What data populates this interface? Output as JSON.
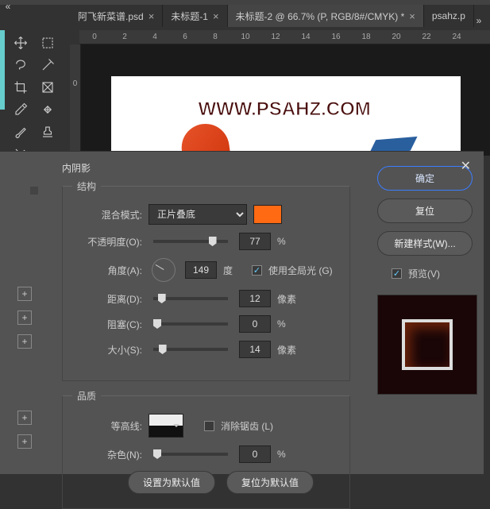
{
  "tabs": [
    {
      "label": "阿飞新菜谱.psd",
      "active": false
    },
    {
      "label": "未标题-1",
      "active": false
    },
    {
      "label": "未标题-2 @ 66.7% (P, RGB/8#/CMYK) *",
      "active": true
    },
    {
      "label": "psahz.p",
      "active": false
    }
  ],
  "ruler": [
    "0",
    "2",
    "4",
    "6",
    "8",
    "10",
    "12",
    "14",
    "16",
    "18",
    "20",
    "22",
    "24"
  ],
  "vruler_marks": [
    "0"
  ],
  "canvas": {
    "watermark": "WWW.PSAHZ.COM"
  },
  "dialog": {
    "effect_title": "内阴影",
    "structure_legend": "结构",
    "quality_legend": "品质",
    "blend_mode_label": "混合模式:",
    "blend_mode_value": "正片叠底",
    "swatch_color": "#ff6a13",
    "opacity_label": "不透明度(O):",
    "opacity_value": "77",
    "opacity_unit": "%",
    "angle_label": "角度(A):",
    "angle_value": "149",
    "angle_unit": "度",
    "global_light_label": "使用全局光 (G)",
    "global_light_checked": true,
    "distance_label": "距离(D):",
    "distance_value": "12",
    "distance_unit": "像素",
    "choke_label": "阻塞(C):",
    "choke_value": "0",
    "choke_unit": "%",
    "size_label": "大小(S):",
    "size_value": "14",
    "size_unit": "像素",
    "contour_label": "等高线:",
    "antialias_label": "消除锯齿 (L)",
    "antialias_checked": false,
    "noise_label": "杂色(N):",
    "noise_value": "0",
    "noise_unit": "%",
    "make_default": "设置为默认值",
    "reset_default": "复位为默认值"
  },
  "buttons": {
    "ok": "确定",
    "cancel": "复位",
    "new_style": "新建样式(W)...",
    "preview": "预览(V)"
  }
}
